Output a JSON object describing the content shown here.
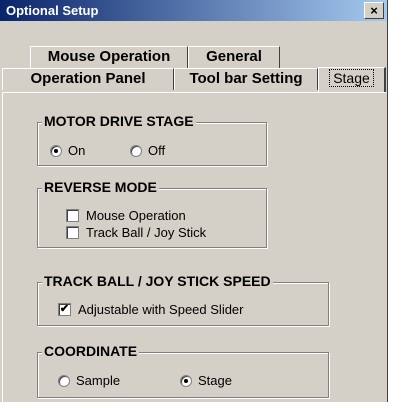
{
  "window": {
    "title": "Optional Setup",
    "close_glyph": "×"
  },
  "tabs": {
    "row1": [
      "Mouse Operation",
      "General"
    ],
    "row2": [
      "Operation Panel",
      "Tool bar Setting",
      "Stage"
    ],
    "active": "Stage"
  },
  "motor_drive_stage": {
    "title": "MOTOR DRIVE STAGE",
    "on_label": "On",
    "off_label": "Off",
    "selected": "On"
  },
  "reverse_mode": {
    "title": "REVERSE MODE",
    "mouse_label": "Mouse Operation",
    "mouse_checked": false,
    "trackball_label": "Track Ball / Joy Stick",
    "trackball_checked": false
  },
  "speed": {
    "title": "TRACK BALL / JOY STICK SPEED",
    "adjustable_label": "Adjustable with Speed Slider",
    "adjustable_checked": true
  },
  "coordinate": {
    "title": "COORDINATE",
    "sample_label": "Sample",
    "stage_label": "Stage",
    "selected": "Stage"
  },
  "colors": {
    "face": "#d4d0c8",
    "title_start": "#0a246a",
    "title_end": "#a6caf0"
  }
}
